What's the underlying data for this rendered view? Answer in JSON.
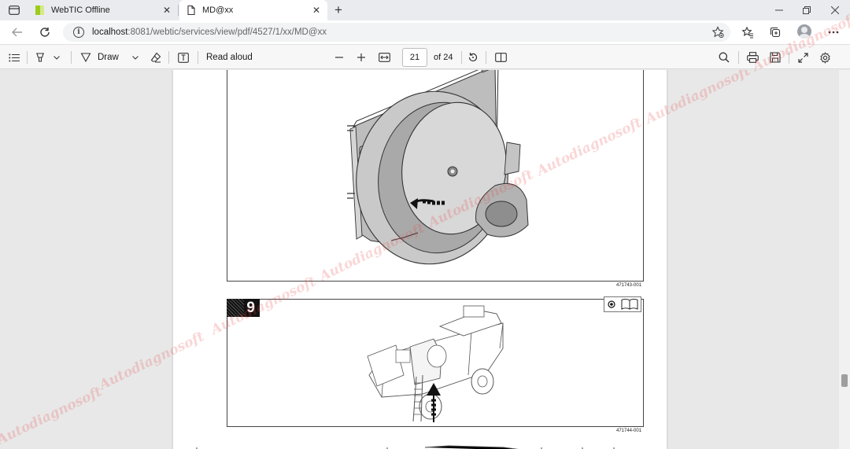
{
  "browser": {
    "tabs": [
      {
        "title": "WebTIC Offline",
        "active": false
      },
      {
        "title": "MD@xx",
        "active": true
      }
    ],
    "address": {
      "host": "localhost",
      "path": ":8081/webtic/services/view/pdf/4527/1/xx/MD@xx"
    }
  },
  "pdf_toolbar": {
    "draw_label": "Draw",
    "read_aloud_label": "Read aloud",
    "current_page": "21",
    "page_total": "of 24"
  },
  "document": {
    "figure_8_id": "471743-001",
    "figure_9_step": "9",
    "figure_9_id": "471744-001"
  },
  "watermark": "Autodiagnosoft",
  "colors": {
    "accent_watermark": "#e64646",
    "toolbar_bg": "#f7f7f7",
    "viewer_bg": "#e8e8e8"
  }
}
